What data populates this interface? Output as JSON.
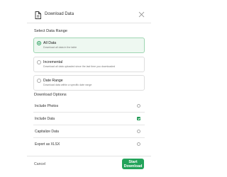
{
  "dialog": {
    "title": "Download Data",
    "icon": "document-icon",
    "close_icon": "close-icon"
  },
  "data_range": {
    "heading": "Select Data Range",
    "selected": "all",
    "options": [
      {
        "id": "all",
        "title": "All Data",
        "description": "Download all data in the table"
      },
      {
        "id": "incremental",
        "title": "Incremental",
        "description": "Download all data uploaded since the last time you downloaded"
      },
      {
        "id": "range",
        "title": "Date Range",
        "description": "Download data within a specific date range"
      }
    ]
  },
  "download_options": {
    "heading": "Download Options",
    "items": [
      {
        "label": "Include Photos",
        "checked": false
      },
      {
        "label": "Include Data",
        "checked": true
      },
      {
        "label": "Capitalize Data",
        "checked": false
      },
      {
        "label": "Export as XLSX",
        "checked": false
      }
    ]
  },
  "footer": {
    "cancel_label": "Cancel",
    "start_label": "Start Download"
  },
  "colors": {
    "accent": "#23a35a",
    "selected_bg": "#eef8f1"
  }
}
